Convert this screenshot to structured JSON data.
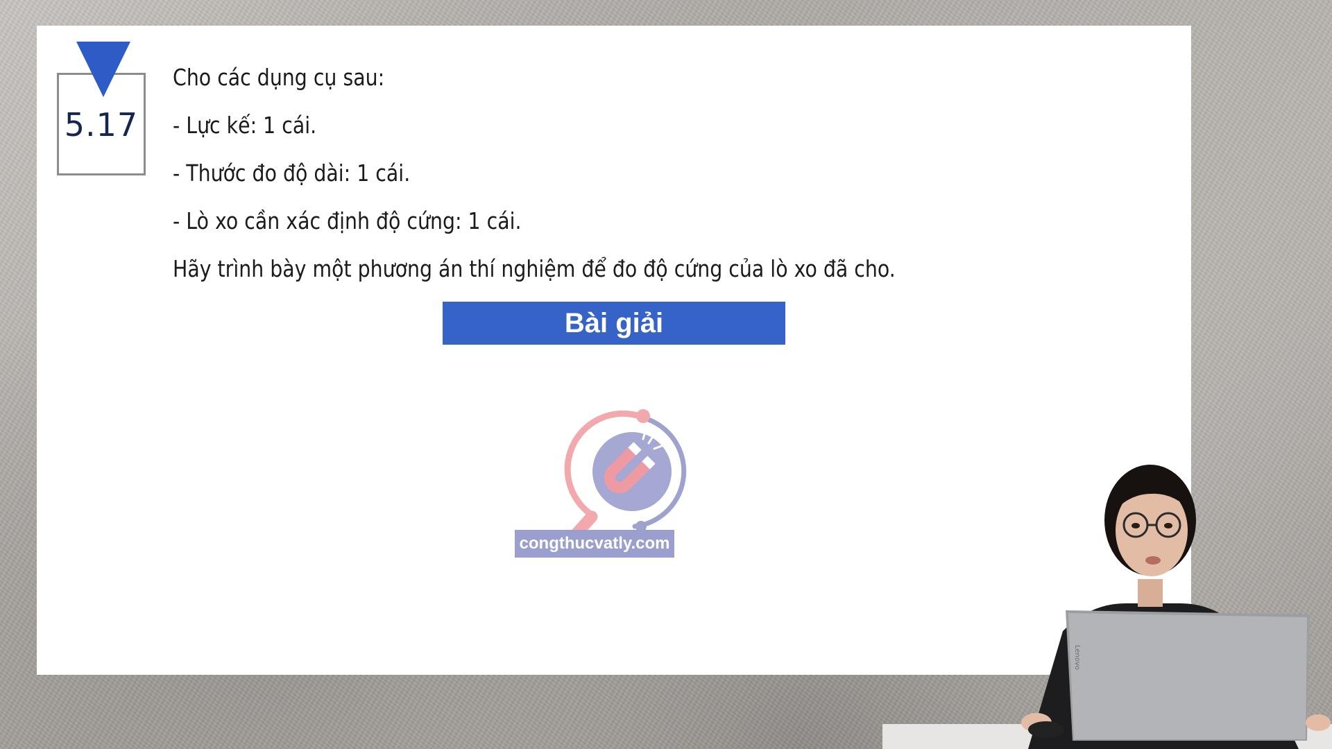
{
  "problem": {
    "number": "5.17",
    "lines": [
      "Cho các dụng cụ sau:",
      "- Lực kế: 1 cái.",
      "- Thước đo độ dài: 1 cái.",
      "- Lò xo cần xác định độ cứng: 1 cái.",
      "Hãy trình bày một phương án thí nghiệm để đo độ cứng của lò xo đã cho."
    ]
  },
  "solution_button": {
    "label": "Bài giải"
  },
  "watermark": {
    "text": "congthucvatly.com",
    "icon": "magnet-magnifier-icon"
  },
  "colors": {
    "accent_blue": "#3563c8",
    "number_text": "#14254f",
    "watermark_bg": "#9a9fce",
    "logo_pink": "#f1a3a8",
    "logo_purple": "#8e93c4"
  }
}
